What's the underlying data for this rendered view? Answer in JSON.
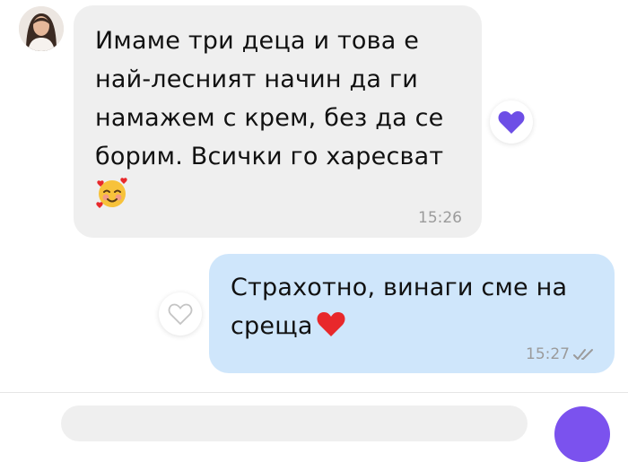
{
  "conversation": {
    "incoming": {
      "text": "Имаме три деца и това е\nнай-лесният начин да ги\nнамажем с крем, без да се\nборим. Всички го харесват",
      "emoji": "smiling-face-with-hearts",
      "time": "15:26",
      "reaction": "purple-heart-icon"
    },
    "outgoing": {
      "text": "Страхотно, винаги сме на\nсреща",
      "emoji": "red-heart",
      "time": "15:27",
      "status": "double-check-icon"
    }
  },
  "colors": {
    "incoming_bubble": "#efefef",
    "outgoing_bubble": "#cfe6fb",
    "accent": "#7b52ee",
    "heart_red": "#e8282b",
    "time_gray": "#9b9b9b"
  }
}
